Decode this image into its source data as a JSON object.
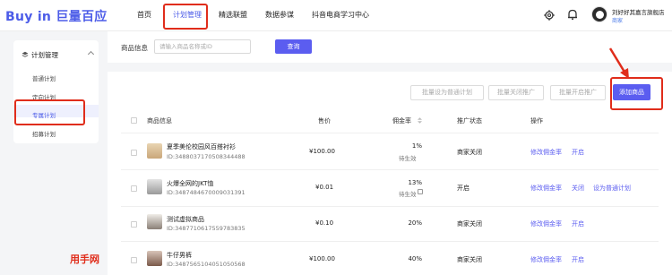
{
  "header": {
    "logo": "Buy in 巨量百应",
    "nav": [
      "首页",
      "计划管理",
      "精选联盟",
      "数据参谋",
      "抖音电商学习中心"
    ],
    "active_nav": "计划管理",
    "shop_name": "刘好好其嘉言旗舰店",
    "shop_badge": "商家"
  },
  "sidebar": {
    "section": "计划管理",
    "items": [
      "普通计划",
      "定向计划",
      "专属计划",
      "招募计划"
    ],
    "active": "专属计划"
  },
  "search": {
    "label": "商品信息",
    "placeholder": "请输入商品名称或ID",
    "button": "查询"
  },
  "actions": {
    "batch_normal": "批量设为普通计划",
    "batch_close": "批量关闭推广",
    "batch_open": "批量开启推广",
    "add": "添加商品"
  },
  "table": {
    "columns": [
      "商品信息",
      "售价",
      "佣金率",
      "推广状态",
      "操作"
    ],
    "rows": [
      {
        "name": "夏季美伦校园风百搭衬衫",
        "id": "ID:3488037170508344488",
        "price": "¥100.00",
        "rate": "1%",
        "pending": "待生效",
        "status": "商家关闭",
        "ops": [
          "修改佣金率",
          "开启"
        ]
      },
      {
        "name": "火爆全网的JKT恤",
        "id": "ID:3487484670009031391",
        "price": "¥0.01",
        "rate": "13%",
        "pending": "待生效",
        "status": "开启",
        "ops": [
          "修改佣金率",
          "关闭",
          "设为普通计划"
        ]
      },
      {
        "name": "测试虚拟商品",
        "id": "ID:3487710617559783835",
        "price": "¥0.10",
        "rate": "20%",
        "pending": "",
        "status": "商家关闭",
        "ops": [
          "修改佣金率",
          "开启"
        ]
      },
      {
        "name": "牛仔男裤",
        "id": "ID:3487565104051050568",
        "price": "¥100.00",
        "rate": "40%",
        "pending": "",
        "status": "商家关闭",
        "ops": [
          "修改佣金率",
          "开启"
        ]
      }
    ]
  },
  "watermark": "用手网",
  "colors": {
    "accent": "#5b5df0",
    "highlight": "#e02d1b"
  }
}
